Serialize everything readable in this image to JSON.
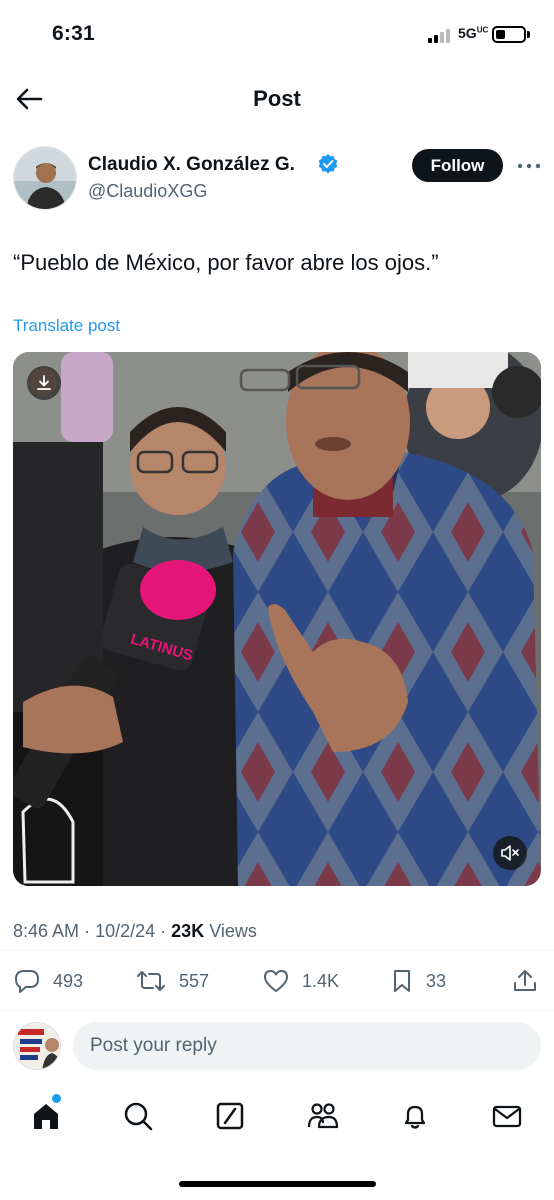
{
  "status_bar": {
    "time": "6:31",
    "network": "5G",
    "network_suffix": "UC",
    "battery_level": 0.35
  },
  "header": {
    "title": "Post",
    "back_icon": "arrow-left-icon"
  },
  "author": {
    "name": "Claudio X. González G.",
    "handle": "@ClaudioXGG",
    "verified": true,
    "follow_label": "Follow",
    "more_icon": "more-horizontal-icon"
  },
  "post": {
    "text": "“Pueblo de México, por favor abre los ojos.”",
    "translate_label": "Translate post",
    "media": {
      "type": "video",
      "microphone_brand": "LATINUS",
      "download_icon": "download-icon",
      "mute_icon": "volume-muted-icon"
    }
  },
  "meta": {
    "time": "8:46 AM",
    "separator": "·",
    "date": "10/2/24",
    "views_count": "23K",
    "views_label": "Views"
  },
  "actions": {
    "replies": "493",
    "reposts": "557",
    "likes": "1.4K",
    "bookmarks": "33"
  },
  "reply": {
    "placeholder": "Post your reply"
  },
  "tab_bar": {
    "items": [
      "home-icon",
      "search-icon",
      "grok-icon",
      "communities-icon",
      "notifications-icon",
      "messages-icon"
    ]
  },
  "colors": {
    "accent": "#1d9bf0",
    "text_primary": "#0f1419",
    "text_secondary": "#536471",
    "follow_bg": "#0f1419",
    "sweater_navy": "#2d4a86",
    "mic_pink": "#e6157a"
  }
}
